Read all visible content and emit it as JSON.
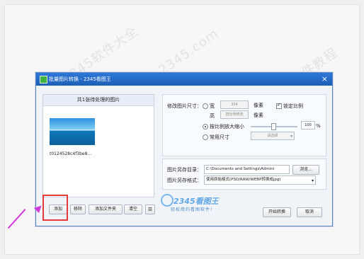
{
  "watermarks": [
    "2345软件大全",
    "www.2345.com",
    "软件教程"
  ],
  "dialog": {
    "title": "批量图片转换 - 2345看图王",
    "close": "×"
  },
  "left": {
    "list_header": "共1张待处理的图片",
    "thumb_caption": "t0124528c4f3be8...",
    "buttons": [
      "添加",
      "移除",
      "添加文件夹",
      "清空"
    ],
    "list_icon": "list-icon"
  },
  "resize": {
    "label": "修改图片尺寸：",
    "width_label": "宽",
    "width_value": "304",
    "height_label": "高",
    "height_value": "按比例修改",
    "unit": "像素",
    "lock_ratio": "锁定比例",
    "scale_label": "按比例放大缩小",
    "scale_value": "100",
    "percent": "%",
    "common_size_label": "常用尺寸",
    "common_size_value": "请选择"
  },
  "save": {
    "dir_label": "图片另存目录：",
    "dir_value": "C:\\Documents and Settings\\Admini",
    "browse": "浏览...",
    "format_label": "图片另存格式：",
    "format_value": "使用原始格式(PSD/RAW/WEBP转换成jpg)"
  },
  "footer": {
    "brand": "2345看图王",
    "slogan": "轻松简约看图软件!",
    "start": "开始转换",
    "cancel": "取消"
  }
}
